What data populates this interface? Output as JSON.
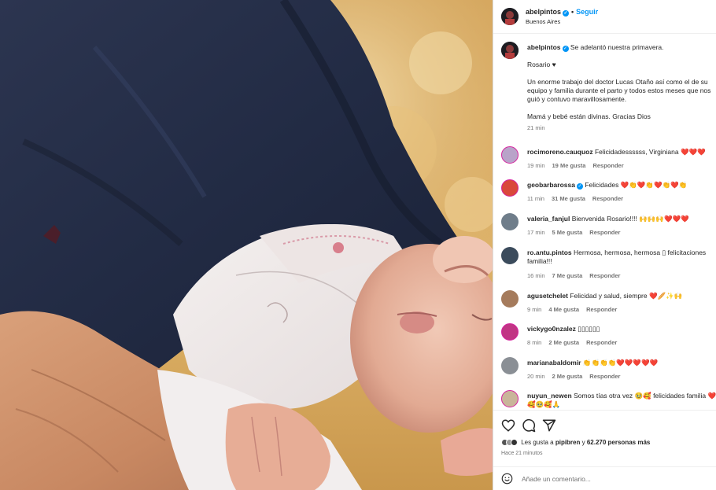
{
  "header": {
    "username": "abelpintos",
    "follow_label": "Seguir",
    "location": "Buenos Aires"
  },
  "caption": {
    "username": "abelpintos",
    "lines": [
      "Se adelantó nuestra primavera.",
      "",
      "Rosario ♥",
      "",
      "Un enorme trabajo del doctor Lucas Otaño así como el de su",
      "equipo y familia durante el parto y todos estos meses que nos",
      "guió y contuvo maravillosamente.",
      "",
      "Mamá y bebé están divinas. Gracias Dios"
    ],
    "time": "21 min"
  },
  "comments": [
    {
      "username": "rocimoreno.cauquoz",
      "text": "Felicidadessssss, Virginiana ❤️❤️❤️",
      "time": "19 min",
      "likes": "19 Me gusta",
      "reply": "Responder",
      "avatar_color": "#b9a3c9",
      "ring": true
    },
    {
      "username": "geobarbarossa",
      "verified": true,
      "text": "Felicidades ❤️👏❤️👏❤️👏❤️👏",
      "time": "11 min",
      "likes": "31 Me gusta",
      "reply": "Responder",
      "avatar_color": "#d9483b",
      "ring": true
    },
    {
      "username": "valeria_fanjul",
      "text": "Bienvenida Rosario!!!! 🙌🙌🙌❤️❤️❤️",
      "time": "17 min",
      "likes": "5 Me gusta",
      "reply": "Responder",
      "avatar_color": "#6f7d8a",
      "ring": false
    },
    {
      "username": "ro.antu.pintos",
      "text": "Hermosa, hermosa, hermosa ▯ felicitaciones",
      "text2": "familia!!!",
      "time": "16 min",
      "likes": "7 Me gusta",
      "reply": "Responder",
      "avatar_color": "#3b4b5c",
      "ring": false
    },
    {
      "username": "agusetchelet",
      "text": "Felicidad y salud, siempre ❤️🥖✨🙌",
      "time": "9 min",
      "likes": "4 Me gusta",
      "reply": "Responder",
      "avatar_color": "#a57b5c",
      "ring": false
    },
    {
      "username": "vickygo0nzalez",
      "text": "▯▯▯▯▯▯",
      "time": "8 min",
      "likes": "2 Me gusta",
      "reply": "Responder",
      "avatar_color": "#c13584",
      "ring": true
    },
    {
      "username": "marianabaldomir",
      "text": "👏👏👏👏❤️❤️❤️❤️❤️",
      "time": "20 min",
      "likes": "2 Me gusta",
      "reply": "Responder",
      "avatar_color": "#8a8f95",
      "ring": false
    },
    {
      "username": "nuyun_newen",
      "text": "Somos tías otra vez 🥹🥰 felicidades familia ❤️",
      "text2": "🥰🥹🥰🙏",
      "time": "",
      "likes": "",
      "reply": "",
      "avatar_color": "#c9b59a",
      "ring": true
    }
  ],
  "actions": {
    "liked_by_prefix": "Les gusta a ",
    "liked_by_user": "pipibren",
    "liked_by_suffix": " y ",
    "likes_count": "62.270 personas más",
    "time_ago": "Hace 21 minutos"
  },
  "add_comment": {
    "placeholder": "Añade un comentario..."
  },
  "colors": {
    "link": "#0095f6",
    "text": "#262626",
    "muted": "#737373",
    "heart": "#ed4956"
  }
}
